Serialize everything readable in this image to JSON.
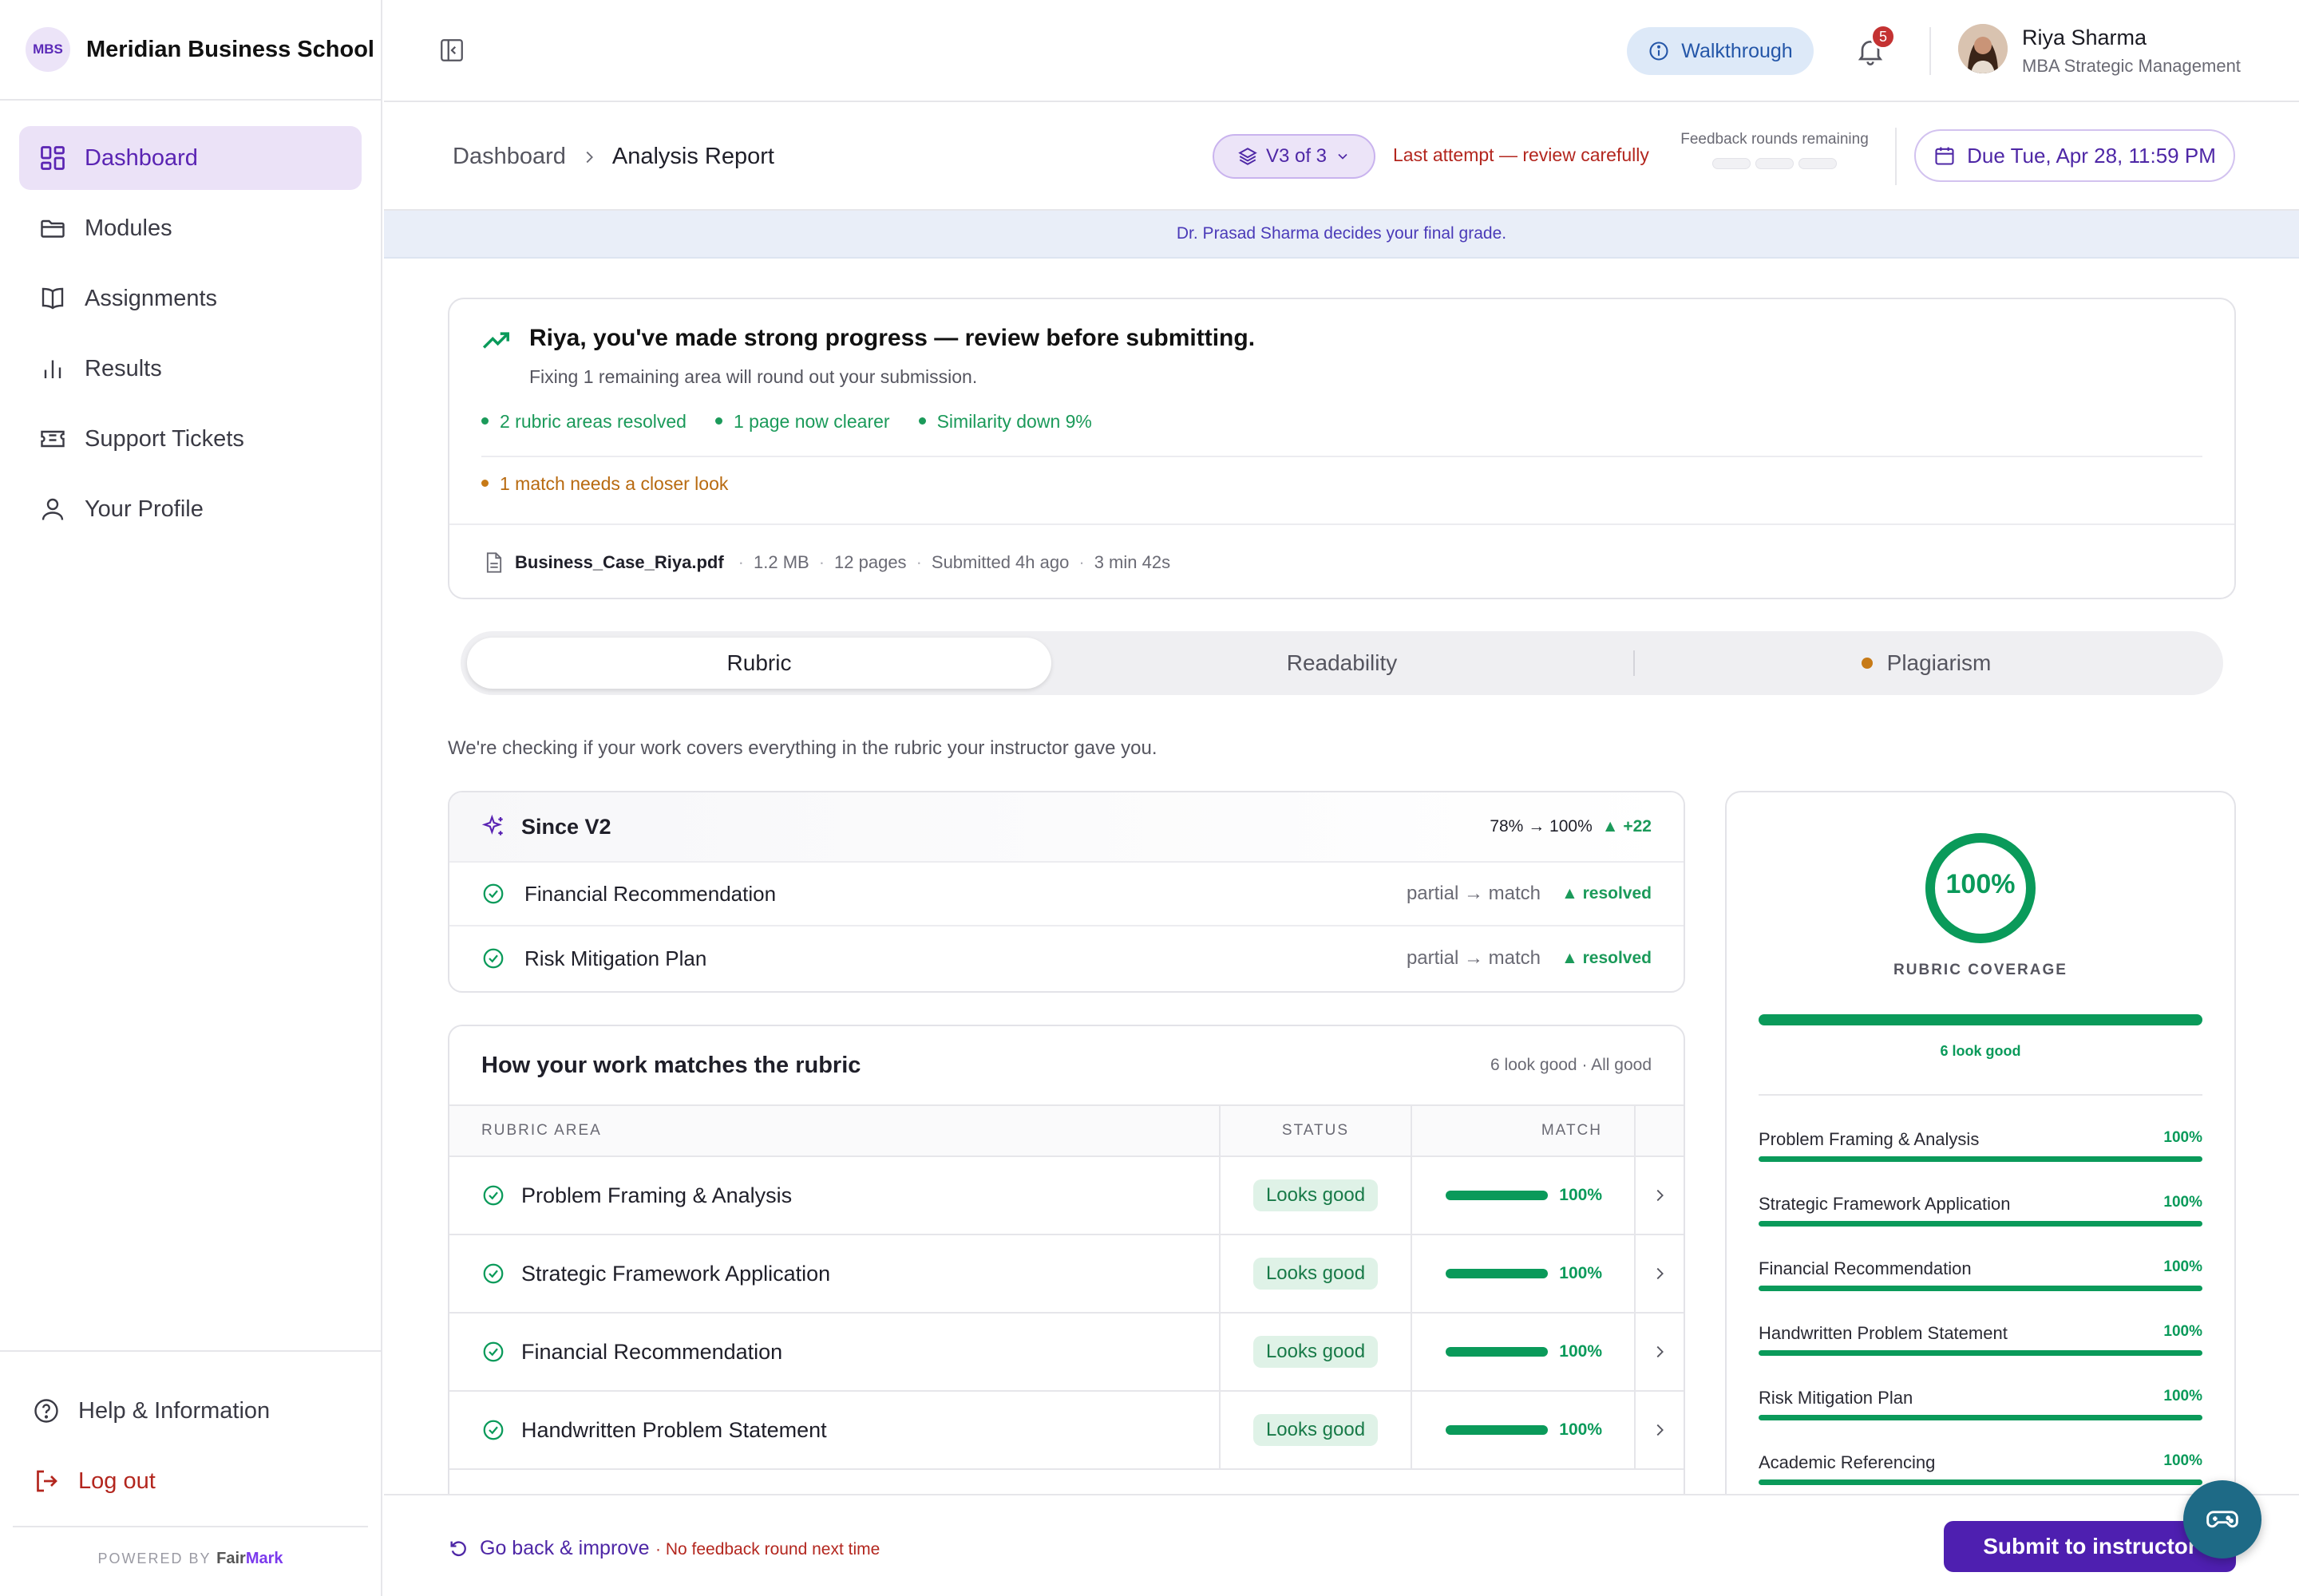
{
  "brand": {
    "logo_text": "MBS",
    "name": "Meridian Business School"
  },
  "sidebar": {
    "items": [
      {
        "label": "Dashboard",
        "icon": "dashboard-icon",
        "active": true
      },
      {
        "label": "Modules",
        "icon": "folder-icon"
      },
      {
        "label": "Assignments",
        "icon": "book-icon"
      },
      {
        "label": "Results",
        "icon": "bar-chart-icon"
      },
      {
        "label": "Support Tickets",
        "icon": "ticket-icon"
      },
      {
        "label": "Your Profile",
        "icon": "user-icon"
      }
    ],
    "help": "Help & Information",
    "logout": "Log out",
    "powered_by": "POWERED BY",
    "powered_brand_a": "Fair",
    "powered_brand_b": "Mark"
  },
  "topbar": {
    "walkthrough": "Walkthrough",
    "notif_count": "5",
    "user_name": "Riya Sharma",
    "user_role": "MBA Strategic Management"
  },
  "subheader": {
    "breadcrumb": [
      "Dashboard",
      "Analysis Report"
    ],
    "version": "V3 of 3",
    "last_attempt": "Last attempt — review carefully",
    "feedback_rounds_label": "Feedback rounds remaining",
    "feedback_rounds_remaining": 0,
    "feedback_rounds_total": 3,
    "due": "Due Tue, Apr 28, 11:59 PM"
  },
  "banner": "Dr. Prasad Sharma decides your final grade.",
  "progress": {
    "title": "Riya, you've made strong progress — review before submitting.",
    "subtitle": "Fixing 1 remaining area will round out your submission.",
    "chips": [
      "2 rubric areas resolved",
      "1 page now clearer",
      "Similarity down 9%"
    ],
    "warning": "1 match needs a closer look",
    "file": {
      "name": "Business_Case_Riya.pdf",
      "size": "1.2 MB",
      "pages": "12 pages",
      "submitted": "Submitted 4h ago",
      "duration": "3 min 42s"
    }
  },
  "tabs": [
    "Rubric",
    "Readability",
    "Plagiarism"
  ],
  "intro": "We're checking if your work covers everything in the rubric your instructor gave you.",
  "since": {
    "title": "Since V2",
    "change": "78% → 100%",
    "delta": "▲ +22",
    "rows": [
      {
        "name": "Financial Recommendation",
        "change": "partial → match",
        "result": "▲ resolved"
      },
      {
        "name": "Risk Mitigation Plan",
        "change": "partial → match",
        "result": "▲ resolved"
      }
    ]
  },
  "matches": {
    "title": "How your work matches the rubric",
    "summary": "6 look good · All good",
    "columns": [
      "RUBRIC AREA",
      "STATUS",
      "MATCH"
    ],
    "rows": [
      {
        "area": "Problem Framing & Analysis",
        "status": "Looks good",
        "match": "100%"
      },
      {
        "area": "Strategic Framework Application",
        "status": "Looks good",
        "match": "100%"
      },
      {
        "area": "Financial Recommendation",
        "status": "Looks good",
        "match": "100%"
      },
      {
        "area": "Handwritten Problem Statement",
        "status": "Looks good",
        "match": "100%"
      }
    ]
  },
  "coverage": {
    "value": "100%",
    "label": "RUBRIC COVERAGE",
    "fill": 1.0,
    "note": "6 look good",
    "items": [
      {
        "name": "Problem Framing & Analysis",
        "pct": "100%"
      },
      {
        "name": "Strategic Framework Application",
        "pct": "100%"
      },
      {
        "name": "Financial Recommendation",
        "pct": "100%"
      },
      {
        "name": "Handwritten Problem Statement",
        "pct": "100%"
      },
      {
        "name": "Risk Mitigation Plan",
        "pct": "100%"
      },
      {
        "name": "Academic Referencing",
        "pct": "100%"
      }
    ]
  },
  "footer": {
    "go_back": "Go back & improve",
    "no_feedback": "· No feedback round next time",
    "submit": "Submit to instructor"
  },
  "colors": {
    "accent": "#4e1fb0",
    "success": "#0a9a5a",
    "danger": "#b3261e",
    "warning": "#c77a17"
  }
}
